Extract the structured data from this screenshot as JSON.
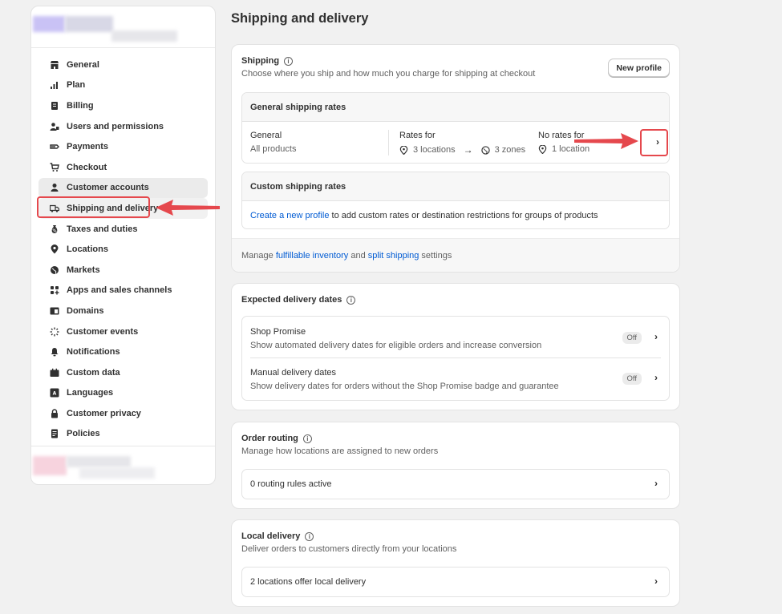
{
  "sidebar": {
    "items": [
      {
        "label": "General",
        "icon": "store-icon"
      },
      {
        "label": "Plan",
        "icon": "plan-icon"
      },
      {
        "label": "Billing",
        "icon": "billing-icon"
      },
      {
        "label": "Users and permissions",
        "icon": "users-icon"
      },
      {
        "label": "Payments",
        "icon": "payments-icon"
      },
      {
        "label": "Checkout",
        "icon": "cart-icon"
      },
      {
        "label": "Customer accounts",
        "icon": "person-icon"
      },
      {
        "label": "Shipping and delivery",
        "icon": "truck-icon"
      },
      {
        "label": "Taxes and duties",
        "icon": "tax-icon"
      },
      {
        "label": "Locations",
        "icon": "location-icon"
      },
      {
        "label": "Markets",
        "icon": "globe-icon"
      },
      {
        "label": "Apps and sales channels",
        "icon": "apps-icon"
      },
      {
        "label": "Domains",
        "icon": "domains-icon"
      },
      {
        "label": "Customer events",
        "icon": "events-icon"
      },
      {
        "label": "Notifications",
        "icon": "bell-icon"
      },
      {
        "label": "Custom data",
        "icon": "data-icon"
      },
      {
        "label": "Languages",
        "icon": "language-icon"
      },
      {
        "label": "Customer privacy",
        "icon": "lock-icon"
      },
      {
        "label": "Policies",
        "icon": "policies-icon"
      }
    ]
  },
  "page": {
    "title": "Shipping and delivery"
  },
  "shipping": {
    "title": "Shipping",
    "subtitle": "Choose where you ship and how much you charge for shipping at checkout",
    "new_profile": "New profile",
    "general_rates_title": "General shipping rates",
    "general_name": "General",
    "general_scope": "All products",
    "rates_for_label": "Rates for",
    "rates_locations": "3 locations",
    "rates_zones": "3 zones",
    "no_rates_label": "No rates for",
    "no_rates_locations": "1 location",
    "custom_rates_title": "Custom shipping rates",
    "custom_link": "Create a new profile",
    "custom_text": " to add custom rates or destination restrictions for groups of products",
    "footer_prefix": "Manage ",
    "footer_link1": "fulfillable inventory",
    "footer_mid": " and ",
    "footer_link2": "split shipping",
    "footer_suffix": " settings"
  },
  "expected": {
    "title": "Expected delivery dates",
    "rows": [
      {
        "title": "Shop Promise",
        "desc": "Show automated delivery dates for eligible orders and increase conversion",
        "status": "Off"
      },
      {
        "title": "Manual delivery dates",
        "desc": "Show delivery dates for orders without the Shop Promise badge and guarantee",
        "status": "Off"
      }
    ]
  },
  "routing": {
    "title": "Order routing",
    "subtitle": "Manage how locations are assigned to new orders",
    "row": "0 routing rules active"
  },
  "local": {
    "title": "Local delivery",
    "subtitle": "Deliver orders to customers directly from your locations",
    "row": "2 locations offer local delivery"
  },
  "colors": {
    "accent_red": "#e5484d",
    "link_blue": "#005bd3"
  }
}
